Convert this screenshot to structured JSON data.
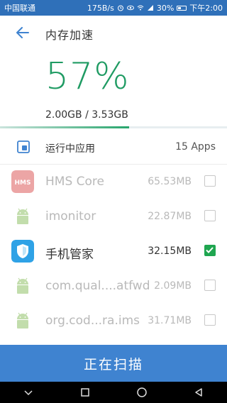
{
  "status_bar": {
    "carrier": "中国联通",
    "speed": "175B/s",
    "battery": "30%",
    "time": "下午2:00"
  },
  "header": {
    "title": "内存加速",
    "percent": "57%",
    "memory": "2.00GB / 3.53GB",
    "usage_fraction": 0.57,
    "accent_color": "#1f9b63"
  },
  "running": {
    "label": "运行中应用",
    "count": "15 Apps"
  },
  "apps": [
    {
      "name": "HMS Core",
      "size": "65.53MB",
      "checked": false,
      "dimmed": true,
      "icon": "hms-core-icon"
    },
    {
      "name": "imonitor",
      "size": "22.87MB",
      "checked": false,
      "dimmed": true,
      "icon": "android-icon"
    },
    {
      "name": "手机管家",
      "size": "32.15MB",
      "checked": true,
      "dimmed": false,
      "icon": "shield-icon"
    },
    {
      "name": "com.qual....atfwd",
      "size": "2.09MB",
      "checked": false,
      "dimmed": true,
      "icon": "android-icon"
    },
    {
      "name": "org.cod...ra.ims",
      "size": "31.71MB",
      "checked": false,
      "dimmed": true,
      "icon": "android-icon"
    }
  ],
  "hms_icon_text": "HMS",
  "scan_button": {
    "label": "正在扫描",
    "color": "#3f83d0"
  },
  "nav": {
    "back": "back-icon",
    "home": "home-icon",
    "recents": "recents-icon",
    "down": "chevron-down-icon"
  }
}
